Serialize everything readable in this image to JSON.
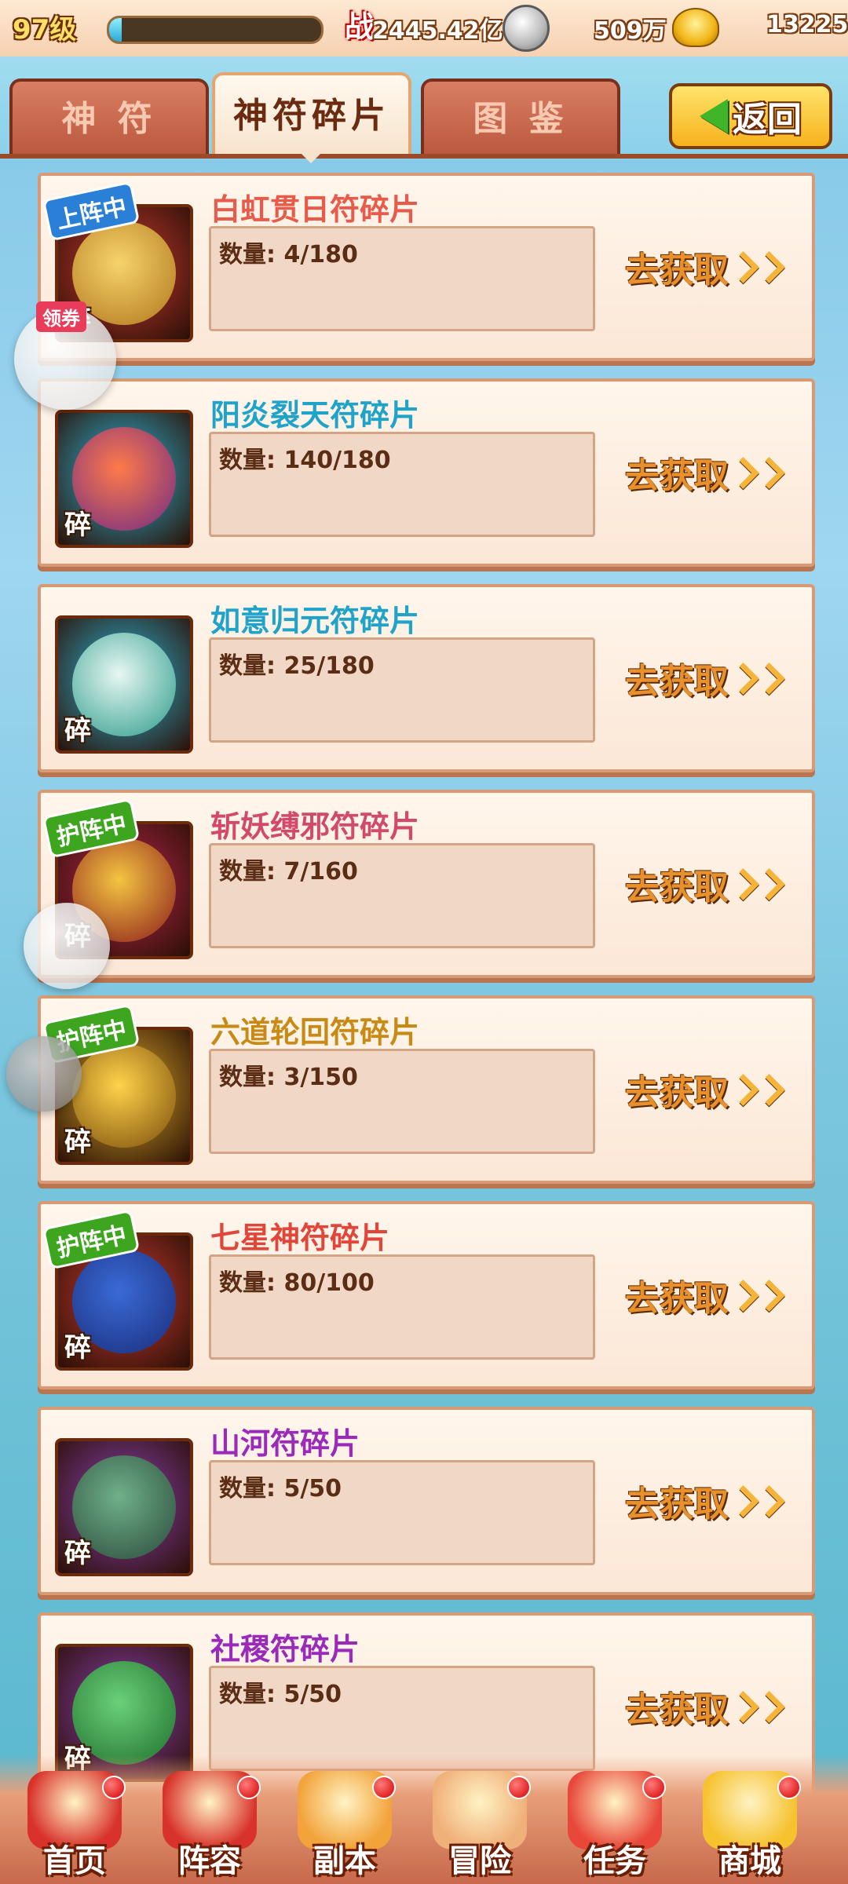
{
  "topbar": {
    "level": "97级",
    "xp_fraction": 0.06,
    "battle_icon": "战",
    "battle_power": "2445.42亿",
    "silver_amount": "509万",
    "gold_amount": "13225"
  },
  "tabs": [
    {
      "label": "神 符",
      "active": false
    },
    {
      "label": "神符碎片",
      "active": true
    },
    {
      "label": "图 鉴",
      "active": false
    }
  ],
  "back_button": {
    "label": "返回"
  },
  "coupon_label": "领券",
  "fragment_mark": "碎",
  "get_label": "去获取",
  "items": [
    {
      "name": "白虹贯日符碎片",
      "qty": "数量: 4/180",
      "badge": "上阵中",
      "badge_color": "blue",
      "name_color": "#e85a4a",
      "frame_color": "#c93a32",
      "art_colors": [
        "#f7d36b",
        "#b0761c"
      ]
    },
    {
      "name": "阳炎裂天符碎片",
      "qty": "数量: 140/180",
      "badge": "",
      "badge_color": "",
      "name_color": "#1fa3c8",
      "frame_color": "#2fb6d6",
      "art_colors": [
        "#ff7a4a",
        "#6e2a85"
      ]
    },
    {
      "name": "如意归元符碎片",
      "qty": "数量: 25/180",
      "badge": "",
      "badge_color": "",
      "name_color": "#1fa3c8",
      "frame_color": "#2fb6d6",
      "art_colors": [
        "#e7f7f2",
        "#2b9b8a"
      ]
    },
    {
      "name": "斩妖缚邪符碎片",
      "qty": "数量: 7/160",
      "badge": "护阵中",
      "badge_color": "green",
      "name_color": "#d24a6a",
      "frame_color": "#b8264a",
      "art_colors": [
        "#f4c542",
        "#8a1a1a"
      ]
    },
    {
      "name": "六道轮回符碎片",
      "qty": "数量: 3/150",
      "badge": "护阵中",
      "badge_color": "green",
      "name_color": "#c88a14",
      "frame_color": "#d8a72a",
      "art_colors": [
        "#ffd34a",
        "#7a4c0c"
      ]
    },
    {
      "name": "七星神符碎片",
      "qty": "数量: 80/100",
      "badge": "护阵中",
      "badge_color": "green",
      "name_color": "#e0463a",
      "frame_color": "#c93a32",
      "art_colors": [
        "#3a6ad6",
        "#1a2d7a"
      ]
    },
    {
      "name": "山河符碎片",
      "qty": "数量: 5/50",
      "badge": "",
      "badge_color": "",
      "name_color": "#9a2bb8",
      "frame_color": "#8a3fb0",
      "art_colors": [
        "#6fb08a",
        "#2b4a3a"
      ]
    },
    {
      "name": "社稷符碎片",
      "qty": "数量: 5/50",
      "badge": "",
      "badge_color": "",
      "name_color": "#9a2bb8",
      "frame_color": "#8a3fb0",
      "art_colors": [
        "#6bd07a",
        "#1d6e2a"
      ]
    }
  ],
  "bottom_nav": [
    {
      "label": "首页",
      "icon": "palace-icon",
      "color": "#d8322a"
    },
    {
      "label": "阵容",
      "icon": "scroll-icon",
      "color": "#d8322a"
    },
    {
      "label": "副本",
      "icon": "cauldron-icon",
      "color": "#f2a33a"
    },
    {
      "label": "冒险",
      "icon": "fist-icon",
      "color": "#f0b07a"
    },
    {
      "label": "任务",
      "icon": "task-scroll-icon",
      "color": "#e8473a"
    },
    {
      "label": "商城",
      "icon": "gold-ingot-icon",
      "color": "#f6c22e"
    }
  ]
}
